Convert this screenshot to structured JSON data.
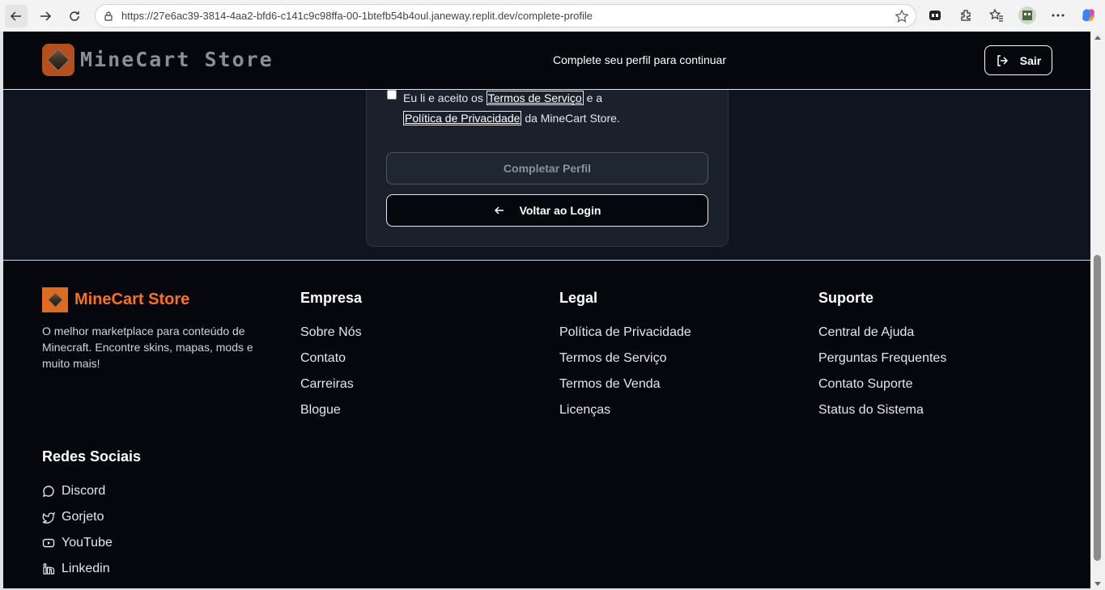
{
  "browser": {
    "url": "https://27e6ac39-3814-4aa2-bfd6-c141c9c98ffa-00-1btefb54b4oul.janeway.replit.dev/complete-profile"
  },
  "header": {
    "brand": "MineCart Store",
    "message": "Complete seu perfil para continuar",
    "logout_label": "Sair"
  },
  "form": {
    "terms_prefix": "Eu li e aceito os",
    "terms_link": "Termos de Serviço",
    "terms_and": "e a",
    "privacy_link": "Política de Privacidade",
    "terms_suffix": "da MineCart Store.",
    "terms_checked": false,
    "complete_label": "Completar Perfil",
    "back_label": "Voltar ao Login"
  },
  "footer": {
    "brand": "MineCart Store",
    "description": "O melhor marketplace para conteúdo de Minecraft. Encontre skins, mapas, mods e muito mais!",
    "columns": [
      {
        "title": "Empresa",
        "links": [
          "Sobre Nós",
          "Contato",
          "Carreiras",
          "Blogue"
        ]
      },
      {
        "title": "Legal",
        "links": [
          "Política de Privacidade",
          "Termos de Serviço",
          "Termos de Venda",
          "Licenças"
        ]
      },
      {
        "title": "Suporte",
        "links": [
          "Central de Ajuda",
          "Perguntas Frequentes",
          "Contato Suporte",
          "Status do Sistema"
        ]
      }
    ],
    "social": {
      "title": "Redes Sociais",
      "links": [
        {
          "label": "Discord",
          "icon": "message-circle-icon"
        },
        {
          "label": "Gorjeto",
          "icon": "twitter-icon"
        },
        {
          "label": "YouTube",
          "icon": "youtube-icon"
        },
        {
          "label": "Linkedin",
          "icon": "linkedin-icon"
        }
      ]
    }
  },
  "colors": {
    "page_bg": "#0f1520",
    "header_bg": "#05070d",
    "accent": "#f97316",
    "logo_bg": "#b5501c"
  }
}
